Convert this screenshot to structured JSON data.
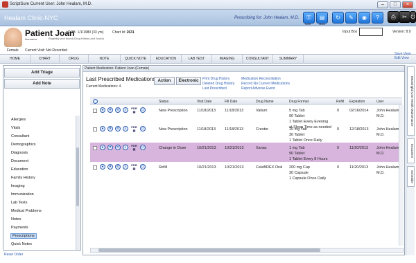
{
  "window": {
    "title": "ScriptSure Current User: John Healam, M.D."
  },
  "header": {
    "clinic": "Healam Clinic-NYC",
    "prescribing_label": "Prescribing for: John Healam, M.D.",
    "toolbar": [
      {
        "name": "lock-icon",
        "label": "Both"
      },
      {
        "name": "clipboard-icon",
        "label": "Tasks"
      },
      {
        "name": "refresh-icon",
        "label": ""
      },
      {
        "name": "pencil-icon",
        "label": ""
      },
      {
        "name": "globe-icon",
        "label": ""
      },
      {
        "name": "help-icon",
        "label": ""
      },
      {
        "name": "print-icon",
        "label": ""
      },
      {
        "name": "tools-icon",
        "label": ""
      },
      {
        "name": "power-icon",
        "label": ""
      }
    ]
  },
  "patient": {
    "name": "Patient Joan",
    "insurance": "Insurance",
    "eligibility": "Eligibility (not found) Drug History (not found)",
    "dob_label": "DOB",
    "dob": "1/1/1980 (33 yrs)",
    "chart_label": "Chart Id:",
    "chart_id": "2631",
    "gender": "Female",
    "current_visit": "Current Visit: Not Recorded",
    "input_box_label": "Input Box",
    "version": "Version: 8.9"
  },
  "nav_tabs": [
    "HOME",
    "CHART",
    "DRUG",
    "NOTE",
    "QUICK NOTE",
    "EDUCATION",
    "LAB TEST",
    "IMAGING",
    "CONSULTANT",
    "SUMMARY"
  ],
  "view_links": {
    "save": "Save View",
    "edit": "Edit View"
  },
  "sidebar": {
    "add_triage": "Add Triage",
    "add_note": "Add Note",
    "items": [
      "Allergies",
      "Vitals",
      "Consultant",
      "Demographics",
      "Diagnosis",
      "Document",
      "Education",
      "Family History",
      "Imaging",
      "Immunization",
      "Lab Tests",
      "Medical Problems",
      "Notes",
      "Payments",
      "Prescriptions",
      "Quick Notes"
    ],
    "selected": "Prescriptions",
    "reset_order": "Reset Order"
  },
  "main": {
    "header": "Patient Medication: Patient Joan (Female)",
    "title": "Last Prescribed Medications",
    "current_meds": "Current Medications: 4",
    "action_btn": "Action",
    "electronic_btn": "Electronic",
    "links_left": [
      "Print Drug History",
      "Deleted Drug History",
      "Last Prescribed"
    ],
    "links_right": [
      "Medication Reconciliation",
      "Record No Current Medications",
      "Report Adverse Event"
    ],
    "columns": [
      "Status",
      "Visit Date",
      "Fill Date",
      "Drug Name",
      "Drug Format",
      "Refill",
      "Expiration",
      "User"
    ],
    "rows": [
      {
        "status": "New Prescription",
        "visit": "11/18/2013",
        "fill": "11/18/2013",
        "drug": "Valium",
        "format": [
          "5 mg Tab",
          "90 Tablet",
          "1 Tablet Every Evening",
          "at Sleep Time as needed"
        ],
        "refill": "0",
        "exp": "02/16/2014",
        "user": [
          "John Healam,",
          "M.D."
        ],
        "selected": false
      },
      {
        "status": "New Prescription",
        "visit": "11/18/2013",
        "fill": "11/18/2013",
        "drug": "Crestor",
        "format": [
          "10 mg Tab",
          "30 Tablet",
          "1 Tablet Once Daily"
        ],
        "refill": "0",
        "exp": "12/18/2013",
        "user": [
          "John Healam,",
          "M.D."
        ],
        "selected": false
      },
      {
        "status": "Change in Dose",
        "visit": "10/21/2013",
        "fill": "10/21/2013",
        "drug": "Xanax",
        "format": [
          "1 mg Tab",
          "90 Tablet",
          "1 Tablet Every 8 Hours"
        ],
        "refill": "0",
        "exp": "11/20/2013",
        "user": [
          "John Healam,",
          "M.D."
        ],
        "selected": true
      },
      {
        "status": "Refill",
        "visit": "10/21/2013",
        "fill": "10/21/2013",
        "drug": "CeleBREX Oral",
        "format": [
          "200 mg Cap",
          "30 Capsule",
          "1 Capsule Once Daily"
        ],
        "refill": "0",
        "exp": "11/20/2013",
        "user": [
          "John Healam,",
          "M.D."
        ],
        "selected": false
      }
    ]
  },
  "right_tabs": [
    "Meaningful Use Health Maintenance",
    "Encounter",
    "Schedule"
  ]
}
